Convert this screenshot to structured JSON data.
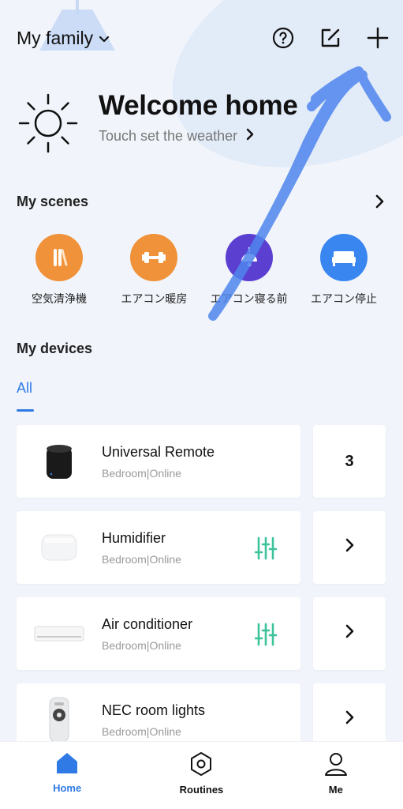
{
  "header": {
    "family_label": "My family",
    "icons": [
      "chevron-down-icon",
      "help-icon",
      "edit-icon",
      "plus-icon"
    ]
  },
  "weather": {
    "title": "Welcome home",
    "subtitle": "Touch set the weather",
    "icon": "sun-icon"
  },
  "scenes": {
    "title": "My scenes",
    "items": [
      {
        "label": "空気清浄機",
        "icon": "air-purifier-icon",
        "color": "#f0923a"
      },
      {
        "label": "エアコン暖房",
        "icon": "dumbbell-icon",
        "color": "#f0923a"
      },
      {
        "label": "エアコン寝る前",
        "icon": "lamp-icon",
        "color": "#5b3fd1"
      },
      {
        "label": "エアコン停止",
        "icon": "bed-icon",
        "color": "#3a86f0"
      }
    ]
  },
  "devices": {
    "title": "My devices",
    "tab_all": "All",
    "items": [
      {
        "name": "Universal Remote",
        "status": "Bedroom|Online",
        "side": "3",
        "has_control": false
      },
      {
        "name": "Humidifier",
        "status": "Bedroom|Online",
        "side": "›",
        "has_control": true
      },
      {
        "name": "Air conditioner",
        "status": "Bedroom|Online",
        "side": "›",
        "has_control": true
      },
      {
        "name": "NEC room lights",
        "status": "Bedroom|Online",
        "side": "›",
        "has_control": false
      }
    ]
  },
  "nav": {
    "items": [
      {
        "label": "Home",
        "icon": "home-icon",
        "active": true
      },
      {
        "label": "Routines",
        "icon": "hexagon-icon",
        "active": false
      },
      {
        "label": "Me",
        "icon": "person-icon",
        "active": false
      }
    ]
  },
  "colors": {
    "accent": "#2f7ae5",
    "control_green": "#3cc39a",
    "scene_orange": "#f0923a",
    "scene_purple": "#5b3fd1",
    "scene_blue": "#3a86f0"
  }
}
